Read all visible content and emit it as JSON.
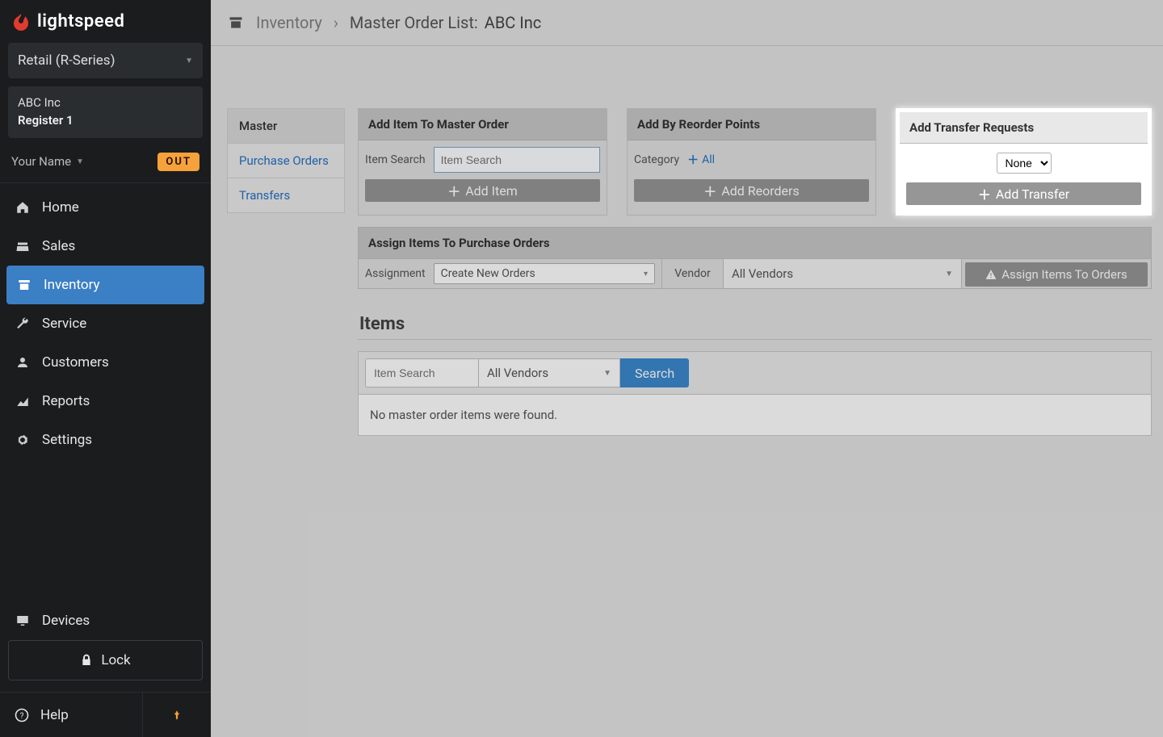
{
  "brand": "lightspeed",
  "product_select": "Retail (R-Series)",
  "store_info": {
    "line1": "ABC Inc",
    "line2": "Register 1"
  },
  "user": {
    "name": "Your Name",
    "badge": "OUT"
  },
  "nav": {
    "home": "Home",
    "sales": "Sales",
    "inventory": "Inventory",
    "service": "Service",
    "customers": "Customers",
    "reports": "Reports",
    "settings": "Settings",
    "devices": "Devices",
    "lock": "Lock",
    "help": "Help"
  },
  "breadcrumb": {
    "root": "Inventory",
    "sep": "›",
    "label": "Master Order List:",
    "value": "ABC Inc"
  },
  "innertabs": {
    "master": "Master",
    "purchase_orders": "Purchase Orders",
    "transfers": "Transfers"
  },
  "panel1": {
    "title": "Add Item To Master Order",
    "label": "Item Search",
    "placeholder": "Item Search",
    "button": "Add Item"
  },
  "panel2": {
    "title": "Add By Reorder Points",
    "label": "Category",
    "link": "All",
    "button": "Add Reorders"
  },
  "panel3": {
    "title": "Add Transfer Requests",
    "select": "None",
    "button": "Add Transfer"
  },
  "assign": {
    "title": "Assign Items To Purchase Orders",
    "assignment_label": "Assignment",
    "assignment_value": "Create New Orders",
    "vendor_label": "Vendor",
    "vendor_value": "All Vendors",
    "button": "Assign Items To Orders"
  },
  "items": {
    "heading": "Items",
    "placeholder": "Item Search",
    "vendor_value": "All Vendors",
    "search": "Search",
    "empty": "No master order items were found."
  }
}
